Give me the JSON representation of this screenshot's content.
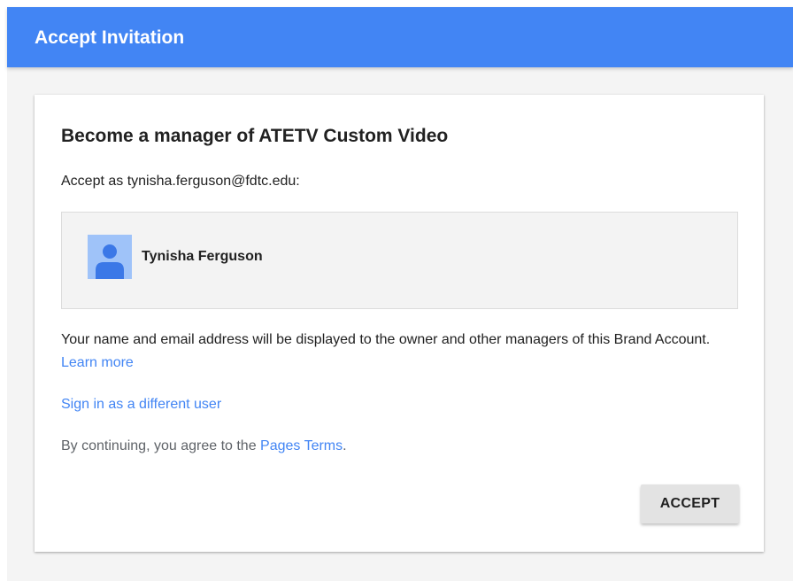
{
  "colors": {
    "header_bg": "#4285f4",
    "link": "#4285f4",
    "page_bg": "#f4f4f4",
    "avatar_bg": "#9fc3f9",
    "avatar_figure": "#3b78e7"
  },
  "header": {
    "title": "Accept Invitation"
  },
  "card": {
    "title": "Become a manager of ATETV Custom Video",
    "accept_as": "Accept as tynisha.ferguson@fdtc.edu:",
    "account": {
      "name": "Tynisha Ferguson",
      "avatar_icon": "person-avatar-icon"
    },
    "disclosure_text": "Your name and email address will be displayed to the owner and other managers of this Brand Account.",
    "learn_more": "Learn more",
    "switch_user": "Sign in as a different user",
    "terms_prefix": "By continuing, you agree to the",
    "terms_link": "Pages Terms",
    "terms_suffix": ".",
    "accept_label": "ACCEPT"
  }
}
